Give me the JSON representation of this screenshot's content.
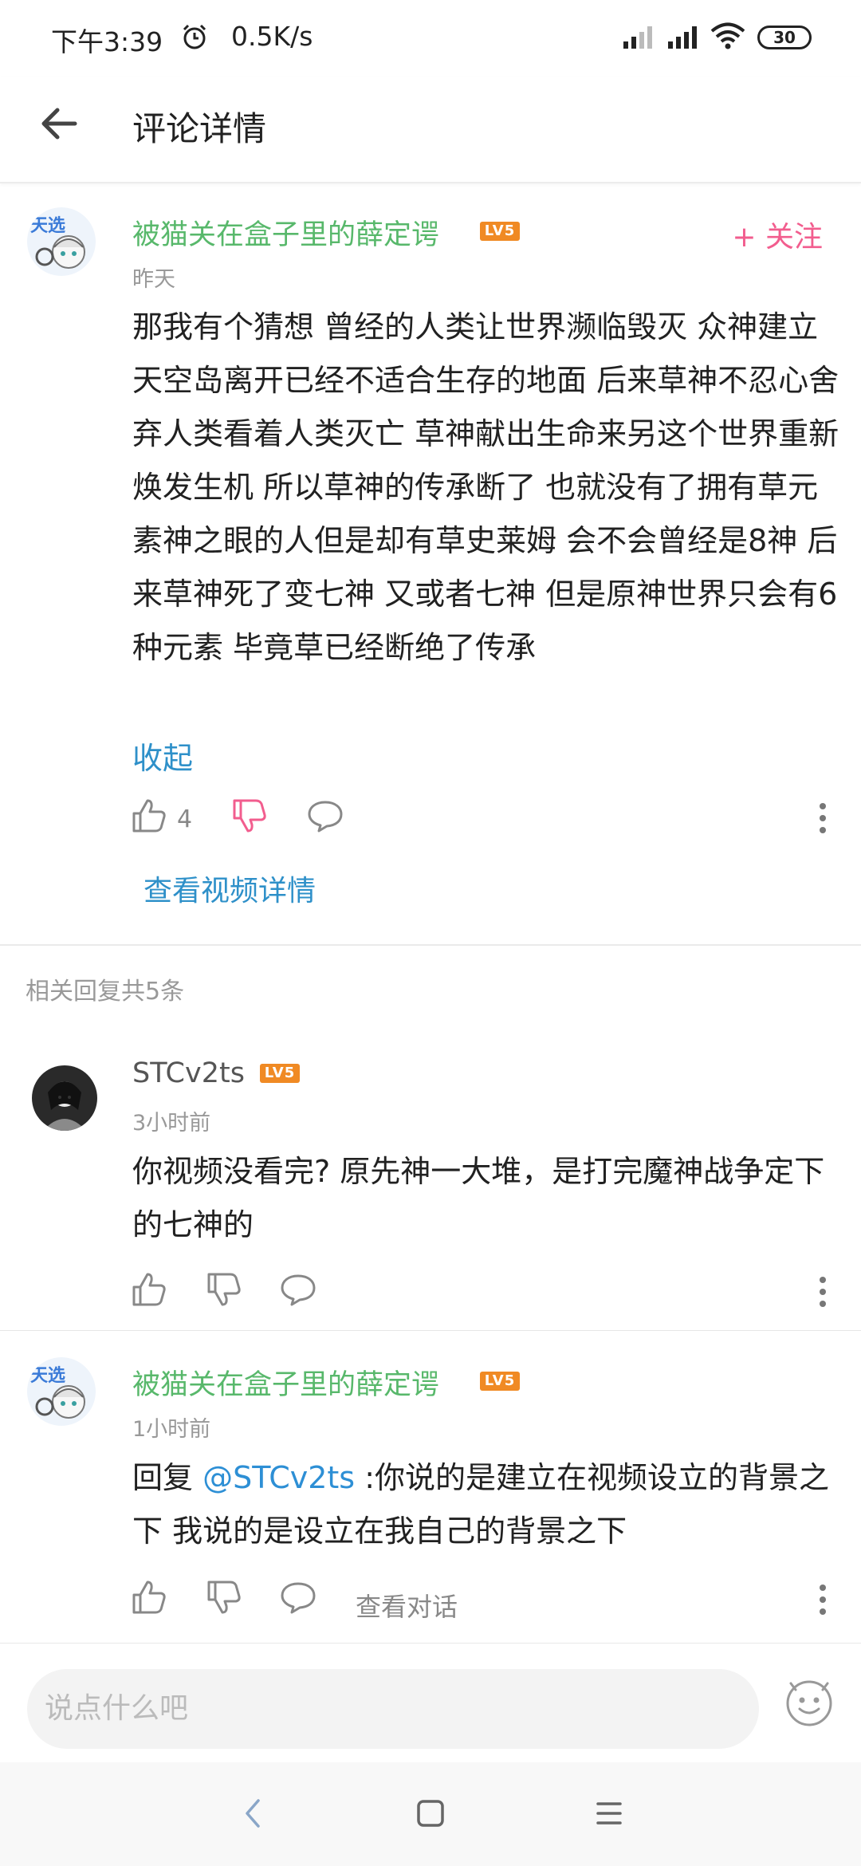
{
  "status_bar": {
    "time": "下午3:39",
    "speed": "0.5K/s",
    "battery": "30"
  },
  "header": {
    "title": "评论详情"
  },
  "main_comment": {
    "username": "被猫关在盒子里的薛定谔",
    "level": "LV5",
    "time": "昨天",
    "follow_label": "+ 关注",
    "content": "那我有个猜想  曾经的人类让世界濒临毁灭  众神建立天空岛离开已经不适合生存的地面    后来草神不忍心舍弃人类看着人类灭亡   草神献出生命来另这个世界重新焕发生机   所以草神的传承断了  也就没有了拥有草元素神之眼的人但是却有草史莱姆   会不会曾经是8神 后来草神死了变七神   又或者七神 但是原神世界只会有6种元素 毕竟草已经断绝了传承",
    "collapse_label": "收起",
    "like_count": "4",
    "view_video_label": "查看视频详情"
  },
  "reply_header": "相关回复共5条",
  "replies": [
    {
      "username": "STCv2ts",
      "level": "LV5",
      "time": "3小时前",
      "content": "你视频没看完? 原先神一大堆，是打完魔神战争定下的七神的"
    },
    {
      "username": "被猫关在盒子里的薛定谔",
      "level": "LV5",
      "time": "1小时前",
      "reply_prefix": "回复 ",
      "mention": "@STCv2ts",
      "content": " :你说的是建立在视频设立的背景之下  我说的是设立在我自己的背景之下",
      "view_dialog_label": "查看对话"
    }
  ],
  "input": {
    "placeholder": "说点什么吧"
  },
  "colors": {
    "vip_name": "#58b86b",
    "link": "#2e90c9",
    "follow": "#f25d8e",
    "dislike_active": "#f25d8e",
    "level_badge": "#f08a24"
  },
  "icons": [
    "alarm-icon",
    "signal-icon",
    "wifi-icon",
    "back-arrow-icon",
    "thumb-up-icon",
    "thumb-down-icon",
    "comment-icon",
    "more-vertical-icon",
    "emoji-icon",
    "nav-back-icon",
    "nav-home-icon",
    "nav-menu-icon"
  ]
}
